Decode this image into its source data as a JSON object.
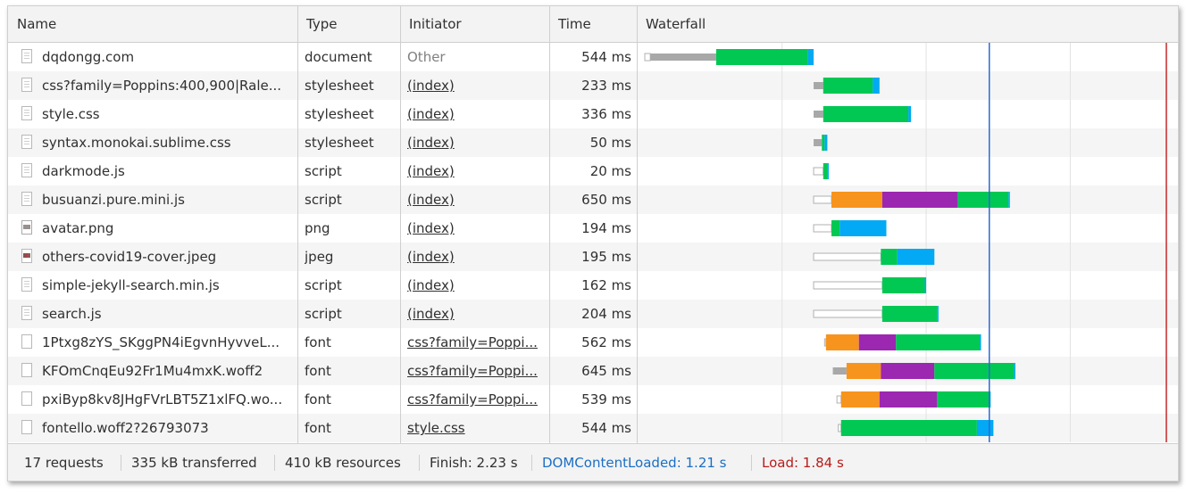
{
  "columns": {
    "name": "Name",
    "type": "Type",
    "initiator": "Initiator",
    "time": "Time",
    "waterfall": "Waterfall"
  },
  "requests": [
    {
      "name": "dqdongg.com",
      "type": "document",
      "initiator": "Other",
      "time": "544 ms",
      "icon": "document-icon",
      "timing_ms": [
        [
          0,
          40,
          "queue"
        ],
        [
          40,
          520,
          "stalled"
        ],
        [
          520,
          1190,
          "waiting"
        ],
        [
          1190,
          1230,
          "download"
        ]
      ]
    },
    {
      "name": "css?family=Poppins:400,900|Rale...",
      "type": "stylesheet",
      "initiator": "(index)",
      "time": "233 ms",
      "icon": "document-icon",
      "timing_ms": [
        [
          1230,
          1300,
          "stalled"
        ],
        [
          1300,
          1660,
          "waiting"
        ],
        [
          1660,
          1710,
          "download"
        ]
      ]
    },
    {
      "name": "style.css",
      "type": "stylesheet",
      "initiator": "(index)",
      "time": "336 ms",
      "icon": "document-icon",
      "timing_ms": [
        [
          1230,
          1300,
          "stalled"
        ],
        [
          1300,
          1920,
          "waiting"
        ],
        [
          1920,
          1940,
          "download"
        ]
      ]
    },
    {
      "name": "syntax.monokai.sublime.css",
      "type": "stylesheet",
      "initiator": "(index)",
      "time": "50 ms",
      "icon": "document-icon",
      "timing_ms": [
        [
          1230,
          1290,
          "stalled"
        ],
        [
          1290,
          1310,
          "waiting"
        ],
        [
          1310,
          1330,
          "download"
        ]
      ]
    },
    {
      "name": "darkmode.js",
      "type": "script",
      "initiator": "(index)",
      "time": "20 ms",
      "icon": "document-icon",
      "timing_ms": [
        [
          1230,
          1300,
          "queue"
        ],
        [
          1300,
          1330,
          "waiting"
        ],
        [
          1330,
          1340,
          "download"
        ]
      ]
    },
    {
      "name": "busuanzi.pure.mini.js",
      "type": "script",
      "initiator": "(index)",
      "time": "650 ms",
      "icon": "document-icon",
      "timing_ms": [
        [
          1230,
          1360,
          "queue"
        ],
        [
          1360,
          1730,
          "dns"
        ],
        [
          1730,
          2280,
          "ssl"
        ],
        [
          2280,
          2650,
          "waiting"
        ],
        [
          2650,
          2660,
          "download"
        ]
      ]
    },
    {
      "name": "avatar.png",
      "type": "png",
      "initiator": "(index)",
      "time": "194 ms",
      "icon": "avatar-icon",
      "timing_ms": [
        [
          1230,
          1360,
          "queue"
        ],
        [
          1360,
          1420,
          "waiting"
        ],
        [
          1420,
          1760,
          "download"
        ]
      ]
    },
    {
      "name": "others-covid19-cover.jpeg",
      "type": "jpeg",
      "initiator": "(index)",
      "time": "195 ms",
      "icon": "image-icon",
      "timing_ms": [
        [
          1230,
          1720,
          "queue"
        ],
        [
          1720,
          1840,
          "waiting"
        ],
        [
          1840,
          2110,
          "download"
        ]
      ]
    },
    {
      "name": "simple-jekyll-search.min.js",
      "type": "script",
      "initiator": "(index)",
      "time": "162 ms",
      "icon": "document-icon",
      "timing_ms": [
        [
          1230,
          1730,
          "queue"
        ],
        [
          1730,
          2040,
          "waiting"
        ],
        [
          2040,
          2050,
          "download"
        ]
      ]
    },
    {
      "name": "search.js",
      "type": "script",
      "initiator": "(index)",
      "time": "204 ms",
      "icon": "document-icon",
      "timing_ms": [
        [
          1230,
          1730,
          "queue"
        ],
        [
          1730,
          2130,
          "waiting"
        ],
        [
          2130,
          2140,
          "download"
        ]
      ]
    },
    {
      "name": "1Ptxg8zYS_SKggPN4iEgvnHyvveL...",
      "type": "font",
      "initiator": "css?family=Poppi...",
      "time": "562 ms",
      "icon": "blank-icon",
      "timing_ms": [
        [
          1310,
          1320,
          "queue"
        ],
        [
          1320,
          1560,
          "dns"
        ],
        [
          1560,
          1830,
          "ssl"
        ],
        [
          1830,
          2440,
          "waiting"
        ],
        [
          2440,
          2450,
          "download"
        ]
      ]
    },
    {
      "name": "KFOmCnqEu92Fr1Mu4mxK.woff2",
      "type": "font",
      "initiator": "css?family=Poppi...",
      "time": "645 ms",
      "icon": "blank-icon",
      "timing_ms": [
        [
          1370,
          1470,
          "stalled"
        ],
        [
          1470,
          1720,
          "dns"
        ],
        [
          1720,
          2110,
          "ssl"
        ],
        [
          2110,
          2690,
          "waiting"
        ],
        [
          2690,
          2700,
          "download"
        ]
      ]
    },
    {
      "name": "pxiByp8kv8JHgFVrLBT5Z1xlFQ.wo...",
      "type": "font",
      "initiator": "css?family=Poppi...",
      "time": "539 ms",
      "icon": "blank-icon",
      "timing_ms": [
        [
          1400,
          1430,
          "queue"
        ],
        [
          1430,
          1710,
          "dns"
        ],
        [
          1710,
          2130,
          "ssl"
        ],
        [
          2130,
          2510,
          "waiting"
        ],
        [
          2510,
          2520,
          "download"
        ]
      ]
    },
    {
      "name": "fontello.woff2?26793073",
      "type": "font",
      "initiator": "style.css",
      "time": "544 ms",
      "icon": "blank-icon",
      "timing_ms": [
        [
          1410,
          1430,
          "queue"
        ],
        [
          1430,
          2420,
          "waiting"
        ],
        [
          2420,
          2540,
          "download"
        ]
      ]
    }
  ],
  "waterfall": {
    "scale_max_ms": 3800,
    "dom_content_loaded_ms": 2510,
    "load_ms": 3800,
    "gridlines_ms": [
      1000,
      2050,
      3100
    ],
    "colors": {
      "queue": "#ffffff",
      "stalled": "#a8a8a8",
      "dns": "#f7941d",
      "ssl": "#9c27b0",
      "waiting": "#00c853",
      "download": "#03a9f4",
      "dcl": "#2b6bd8",
      "load": "#c62828",
      "grid": "#e2e2e2"
    }
  },
  "footer": {
    "requests": "17 requests",
    "transferred": "335 kB transferred",
    "resources": "410 kB resources",
    "finish": "Finish: 2.23 s",
    "dcl": "DOMContentLoaded: 1.21 s",
    "load": "Load: 1.84 s",
    "dcl_color": "#1a6fc4",
    "load_color": "#b71c1c"
  }
}
